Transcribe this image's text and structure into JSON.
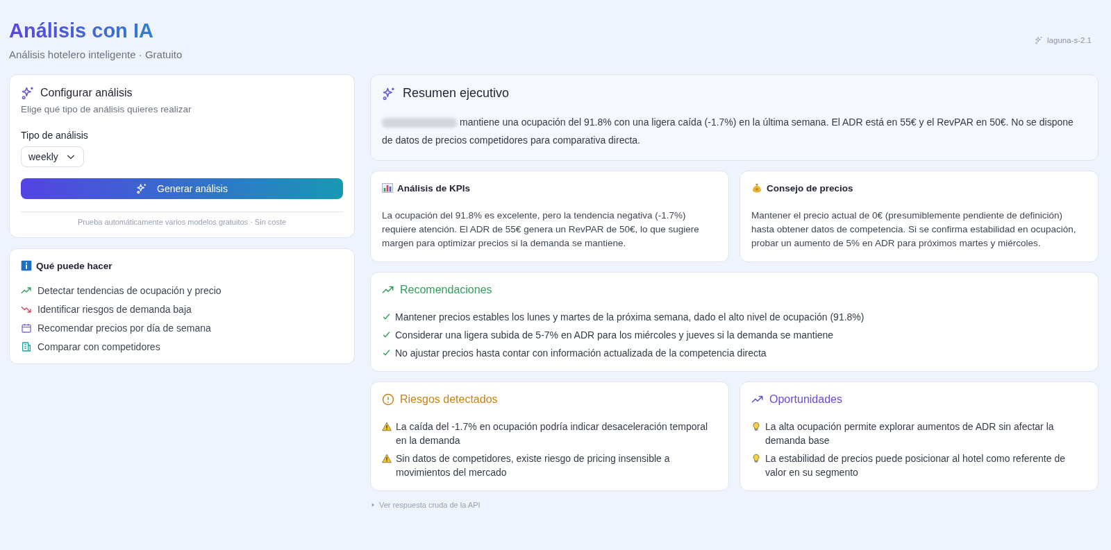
{
  "header": {
    "title": "Análisis con IA",
    "subtitle": "Análisis hotelero inteligente · Gratuito",
    "model_badge": "laguna-s-2.1"
  },
  "config": {
    "title": "Configurar análisis",
    "subtitle": "Elige qué tipo de análisis quieres realizar",
    "field_label": "Tipo de análisis",
    "select_value": "weekly",
    "button": "Generar análisis",
    "note": "Prueba automáticamente varios modelos gratuitos · Sin coste"
  },
  "capabilities": {
    "title": "Qué puede hacer",
    "items": [
      {
        "kind": "trend-up",
        "text": "Detectar tendencias de ocupación y precio"
      },
      {
        "kind": "trend-down",
        "text": "Identificar riesgos de demanda baja"
      },
      {
        "kind": "calendar",
        "text": "Recomendar precios por día de semana"
      },
      {
        "kind": "building",
        "text": "Comparar con competidores"
      }
    ]
  },
  "summary": {
    "title": "Resumen ejecutivo",
    "text": "mantiene una ocupación del 91.8% con una ligera caída (-1.7%) en la última semana. El ADR está en 55€ y el RevPAR en 50€. No se dispone de datos de precios competidores para comparativa directa."
  },
  "kpis": {
    "title": "Análisis de KPIs",
    "text": "La ocupación del 91.8% es excelente, pero la tendencia negativa (-1.7%) requiere atención. El ADR de 55€ genera un RevPAR de 50€, lo que sugiere margen para optimizar precios si la demanda se mantiene."
  },
  "pricing": {
    "title": "Consejo de precios",
    "text": "Mantener el precio actual de 0€ (presumiblemente pendiente de definición) hasta obtener datos de competencia. Si se confirma estabilidad en ocupación, probar un aumento de 5% en ADR para próximos martes y miércoles."
  },
  "recommendations": {
    "title": "Recomendaciones",
    "items": [
      "Mantener precios estables los lunes y martes de la próxima semana, dado el alto nivel de ocupación (91.8%)",
      "Considerar una ligera subida de 5-7% en ADR para los miércoles y jueves si la demanda se mantiene",
      "No ajustar precios hasta contar con información actualizada de la competencia directa"
    ]
  },
  "risks": {
    "title": "Riesgos detectados",
    "items": [
      "La caída del -1.7% en ocupación podría indicar desaceleración temporal en la demanda",
      "Sin datos de competidores, existe riesgo de pricing insensible a movimientos del mercado"
    ]
  },
  "opportunities": {
    "title": "Oportunidades",
    "items": [
      "La alta ocupación permite explorar aumentos de ADR sin afectar la demanda base",
      "La estabilidad de precios puede posicionar al hotel como referente de valor en su segmento"
    ]
  },
  "raw_toggle": {
    "label": "Ver respuesta cruda de la API"
  }
}
